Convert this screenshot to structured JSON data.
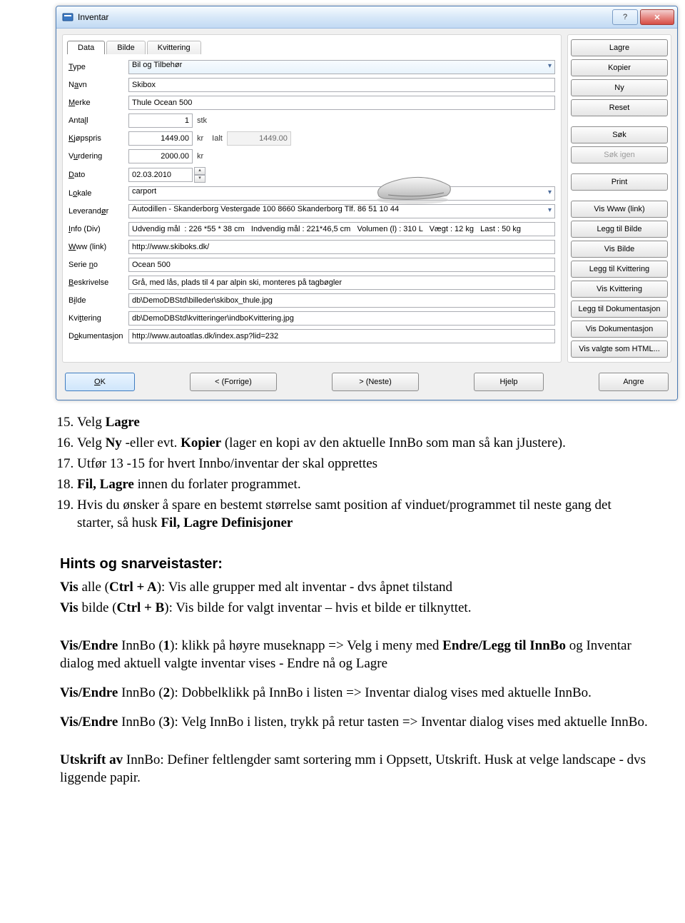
{
  "window": {
    "title": "Inventar",
    "icon": "app-icon"
  },
  "tabs": {
    "data": "Data",
    "bilde": "Bilde",
    "kvittering": "Kvittering"
  },
  "labels": {
    "type": "Type",
    "navn": "Navn",
    "merke": "Merke",
    "antall": "Antall",
    "kjopspris": "Kjøpspris",
    "vurdering": "Vurdering",
    "dato": "Dato",
    "lokale": "Lokale",
    "leverandor": "Leverandør",
    "info": "Info (Div)",
    "www": "Www (link)",
    "serie": "Serie no",
    "beskrivelse": "Beskrivelse",
    "bilde": "Bilde",
    "kvittering": "Kvittering",
    "dokumentasjon": "Dokumentasjon",
    "stk": "stk",
    "kr": "kr",
    "ialt": "Ialt"
  },
  "values": {
    "type": "Bil og Tilbehør",
    "navn": "Skibox",
    "merke": "Thule Ocean 500",
    "antall": "1",
    "kjopspris": "1449.00",
    "ialt": "1449.00",
    "vurdering": "2000.00",
    "dato": "02.03.2010",
    "lokale": "carport",
    "leverandor": "Autodillen - Skanderborg Vestergade 100 8660 Skanderborg Tlf. 86 51 10 44",
    "info": "Udvendig mål  : 226 *55 * 38 cm   Indvendig mål : 221*46,5 cm   Volumen (l) : 310 L   Vægt : 12 kg   Last : 50 kg",
    "www": "http://www.skiboks.dk/",
    "serie": "Ocean 500",
    "beskrivelse": "Grå, med lås, plads til 4 par alpin ski, monteres på tagbøgler",
    "bilde": "db\\DemoDBStd\\billeder\\skibox_thule.jpg",
    "kvittering": "db\\DemoDBStd\\kvitteringer\\indboKvittering.jpg",
    "dokumentasjon": "http://www.autoatlas.dk/index.asp?lid=232"
  },
  "sideButtons": {
    "lagre": "Lagre",
    "kopier": "Kopier",
    "ny": "Ny",
    "reset": "Reset",
    "sok": "Søk",
    "sokIgen": "Søk igen",
    "print": "Print",
    "viswww": "Vis Www (link)",
    "leggBilde": "Legg til Bilde",
    "visBilde": "Vis Bilde",
    "leggKvit": "Legg til Kvittering",
    "visKvit": "Vis Kvittering",
    "leggDok": "Legg til Dokumentasjon",
    "visDok": "Vis Dokumentasjon",
    "visHtml": "Vis valgte som HTML..."
  },
  "bottomButtons": {
    "ok": "OK",
    "prev": "< (Forrige)",
    "next": "> (Neste)",
    "help": "Hjelp",
    "angre": "Angre"
  },
  "article": {
    "li15": [
      "Velg ",
      "Lagre"
    ],
    "li16": [
      "Velg ",
      "Ny",
      " -eller evt. ",
      "Kopier",
      " (lager en kopi av den aktuelle InnBo som man så kan jJustere)."
    ],
    "li17": "Utfør 13 -15 for hvert Innbo/inventar der skal opprettes",
    "li18": [
      "Fil, Lagre",
      " innen du forlater programmet."
    ],
    "li19": [
      "Hvis du ønsker å spare en bestemt størrelse samt position af vinduet/programmet til neste gang det starter, så husk ",
      "Fil, Lagre Definisjoner"
    ],
    "hintsHeading": "Hints og snarveistaster:",
    "p1": [
      "Vis",
      " alle (",
      "Ctrl + A",
      "): Vis alle grupper med alt inventar - dvs åpnet tilstand"
    ],
    "p2": [
      "Vis",
      " bilde (",
      "Ctrl + B",
      "): Vis bilde for valgt inventar – hvis et bilde er tilknyttet."
    ],
    "p3": [
      "Vis/Endre",
      " InnBo (",
      "1",
      "): klikk på høyre museknapp => Velg i meny med ",
      "Endre/Legg til InnBo",
      " og Inventar dialog med aktuell valgte inventar vises  - Endre nå og Lagre"
    ],
    "p4": [
      "Vis/Endre",
      " InnBo (",
      "2",
      "): Dobbelklikk på InnBo i listen => Inventar dialog vises med aktuelle InnBo."
    ],
    "p5": [
      "Vis/Endre",
      " InnBo (",
      "3",
      "): Velg InnBo i listen, trykk på retur tasten  => Inventar dialog vises med aktuelle InnBo."
    ],
    "p6": [
      "Utskrift av",
      " InnBo: Definer feltlengder samt sortering mm i Oppsett, Utskrift. Husk at velge landscape - dvs liggende papir."
    ]
  }
}
